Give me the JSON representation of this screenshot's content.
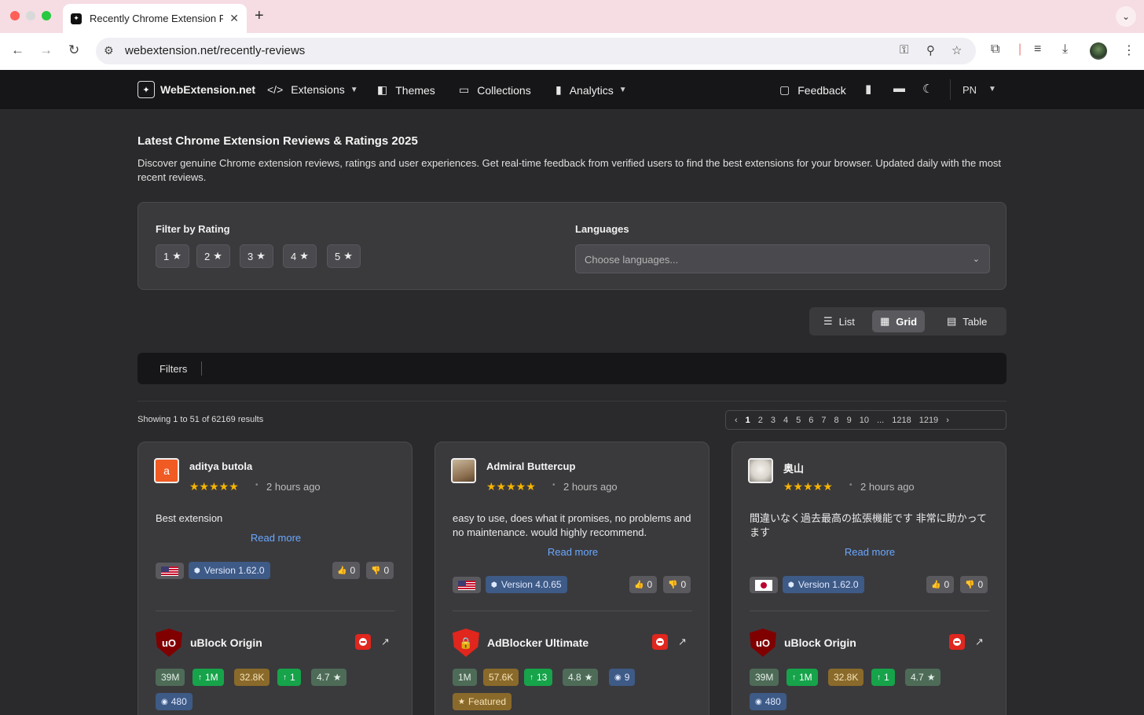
{
  "browser": {
    "tab_title": "Recently Chrome Extension R",
    "url": "webextension.net/recently-reviews"
  },
  "nav": {
    "brand": "WebExtension.net",
    "items": [
      "Extensions",
      "Themes",
      "Collections",
      "Analytics"
    ],
    "feedback": "Feedback",
    "lang": "PN"
  },
  "page": {
    "title": "Latest Chrome Extension Reviews & Ratings 2025",
    "description": "Discover genuine Chrome extension reviews, ratings and user experiences. Get real-time feedback from verified users to find the best extensions for your browser. Updated daily with the most recent reviews."
  },
  "filters": {
    "rating_label": "Filter by Rating",
    "ratings": [
      "1",
      "2",
      "3",
      "4",
      "5"
    ],
    "languages_label": "Languages",
    "languages_placeholder": "Choose languages..."
  },
  "view_toggle": {
    "list": "List",
    "grid": "Grid",
    "table": "Table",
    "active": "Grid"
  },
  "filterbar_label": "Filters",
  "results_text": "Showing 1 to 51 of 62169 results",
  "pagination": [
    "1",
    "2",
    "3",
    "4",
    "5",
    "6",
    "7",
    "8",
    "9",
    "10",
    "...",
    "1218",
    "1219"
  ],
  "accent_colors": {
    "star": "#f5b400",
    "link": "#6aa8ff",
    "green_badge": "#16a34a",
    "block_red": "#e0261d"
  },
  "cards": [
    {
      "reviewer": "aditya butola",
      "avatar_letter": "a",
      "stars": "★★★★★",
      "rating": 5,
      "time": "2 hours ago",
      "text": "Best extension",
      "read_more": "Read more",
      "flag": "us-flag",
      "version": "Version 1.62.0",
      "likes": "0",
      "dislikes": "0",
      "extension": {
        "name": "uBlock Origin",
        "logo_text": "uO",
        "badges": [
          "39M",
          "1M",
          "32.8K",
          "1",
          "4.7"
        ],
        "badges2": [
          "480"
        ]
      }
    },
    {
      "reviewer": "Admiral Buttercup",
      "stars": "★★★★★",
      "rating": 5,
      "time": "2 hours ago",
      "text": "easy to use, does what it promises, no problems and no maintenance. would highly recommend.",
      "read_more": "Read more",
      "flag": "us-flag",
      "version": "Version 4.0.65",
      "likes": "0",
      "dislikes": "0",
      "extension": {
        "name": "AdBlocker Ultimate",
        "badges": [
          "1M",
          "57.6K",
          "13",
          "4.8",
          "9"
        ],
        "badges2": [
          "Featured"
        ]
      }
    },
    {
      "reviewer": "奥山",
      "stars": "★★★★★",
      "rating": 5,
      "time": "2 hours ago",
      "text": "間違いなく過去最高の拡張機能です 非常に助かってます",
      "read_more": "Read more",
      "flag": "jp-flag",
      "version": "Version 1.62.0",
      "likes": "0",
      "dislikes": "0",
      "extension": {
        "name": "uBlock Origin",
        "logo_text": "uO",
        "badges": [
          "39M",
          "1M",
          "32.8K",
          "1",
          "4.7"
        ],
        "badges2": [
          "480"
        ]
      }
    }
  ]
}
